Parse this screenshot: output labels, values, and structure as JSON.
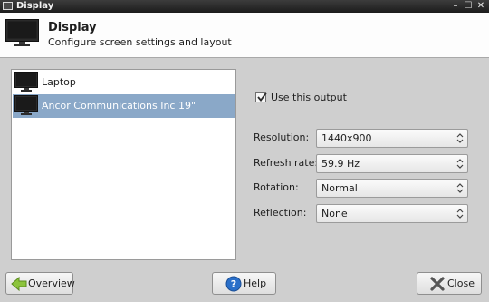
{
  "window": {
    "title": "Display"
  },
  "header": {
    "title": "Display",
    "subtitle": "Configure screen settings and layout"
  },
  "outputs": [
    {
      "label": "Laptop",
      "selected": false
    },
    {
      "label": "Ancor Communications Inc 19\"",
      "selected": true
    }
  ],
  "use_output": {
    "label": "Use this output",
    "checked": true
  },
  "fields": {
    "resolution": {
      "label": "Resolution:",
      "value": "1440x900"
    },
    "refresh_rate": {
      "label": "Refresh rate:",
      "value": "59.9 Hz"
    },
    "rotation": {
      "label": "Rotation:",
      "value": "Normal"
    },
    "reflection": {
      "label": "Reflection:",
      "value": "None"
    }
  },
  "buttons": {
    "overview": "Overview",
    "help": "Help",
    "close": "Close"
  },
  "colors": {
    "selection": "#8aa8c8",
    "overview_arrow": "#8cc43c",
    "help_icon": "#2a6fc9",
    "close_x": "#555555"
  },
  "icons": [
    "monitor-icon",
    "overview-arrow-icon",
    "help-icon",
    "close-icon",
    "combo-arrows-icon",
    "checkbox-check-icon"
  ]
}
